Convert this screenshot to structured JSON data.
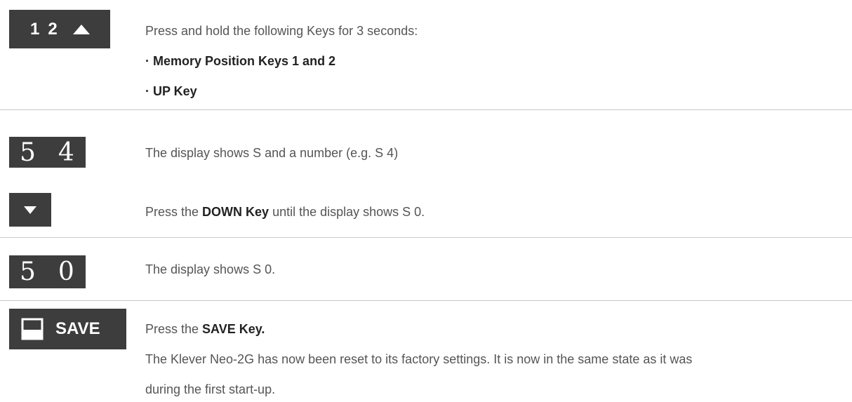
{
  "steps": [
    {
      "key": {
        "label_1": "1",
        "label_2": "2",
        "icon": "arrow-up-icon"
      },
      "text": "Press and hold the following Keys for 3 seconds:",
      "bullets": [
        "· Memory Position Keys 1 and 2",
        "· UP Key"
      ]
    },
    {
      "display": {
        "char_1": "5",
        "char_2": "4"
      },
      "text": "The display shows S and a number (e.g. S 4)"
    },
    {
      "key": {
        "icon": "arrow-down-icon"
      },
      "text_before": "Press the ",
      "text_bold": "DOWN Key",
      "text_after": " until the display shows S 0."
    },
    {
      "display": {
        "char_1": "5",
        "char_2": "0"
      },
      "text": "The display shows S 0."
    },
    {
      "key": {
        "label": "SAVE",
        "icon": "save-square-icon"
      },
      "text_before": "Press the ",
      "text_bold": "SAVE Key.",
      "paragraph_line_1": "The Klever Neo-2G has now been reset to its factory settings. It is now in the same state as it was",
      "paragraph_line_2": "during the first start-up."
    }
  ],
  "colors": {
    "key_bg": "#3d3d3d",
    "divider": "#c8c8c8",
    "text": "#555555",
    "strong": "#222222"
  }
}
